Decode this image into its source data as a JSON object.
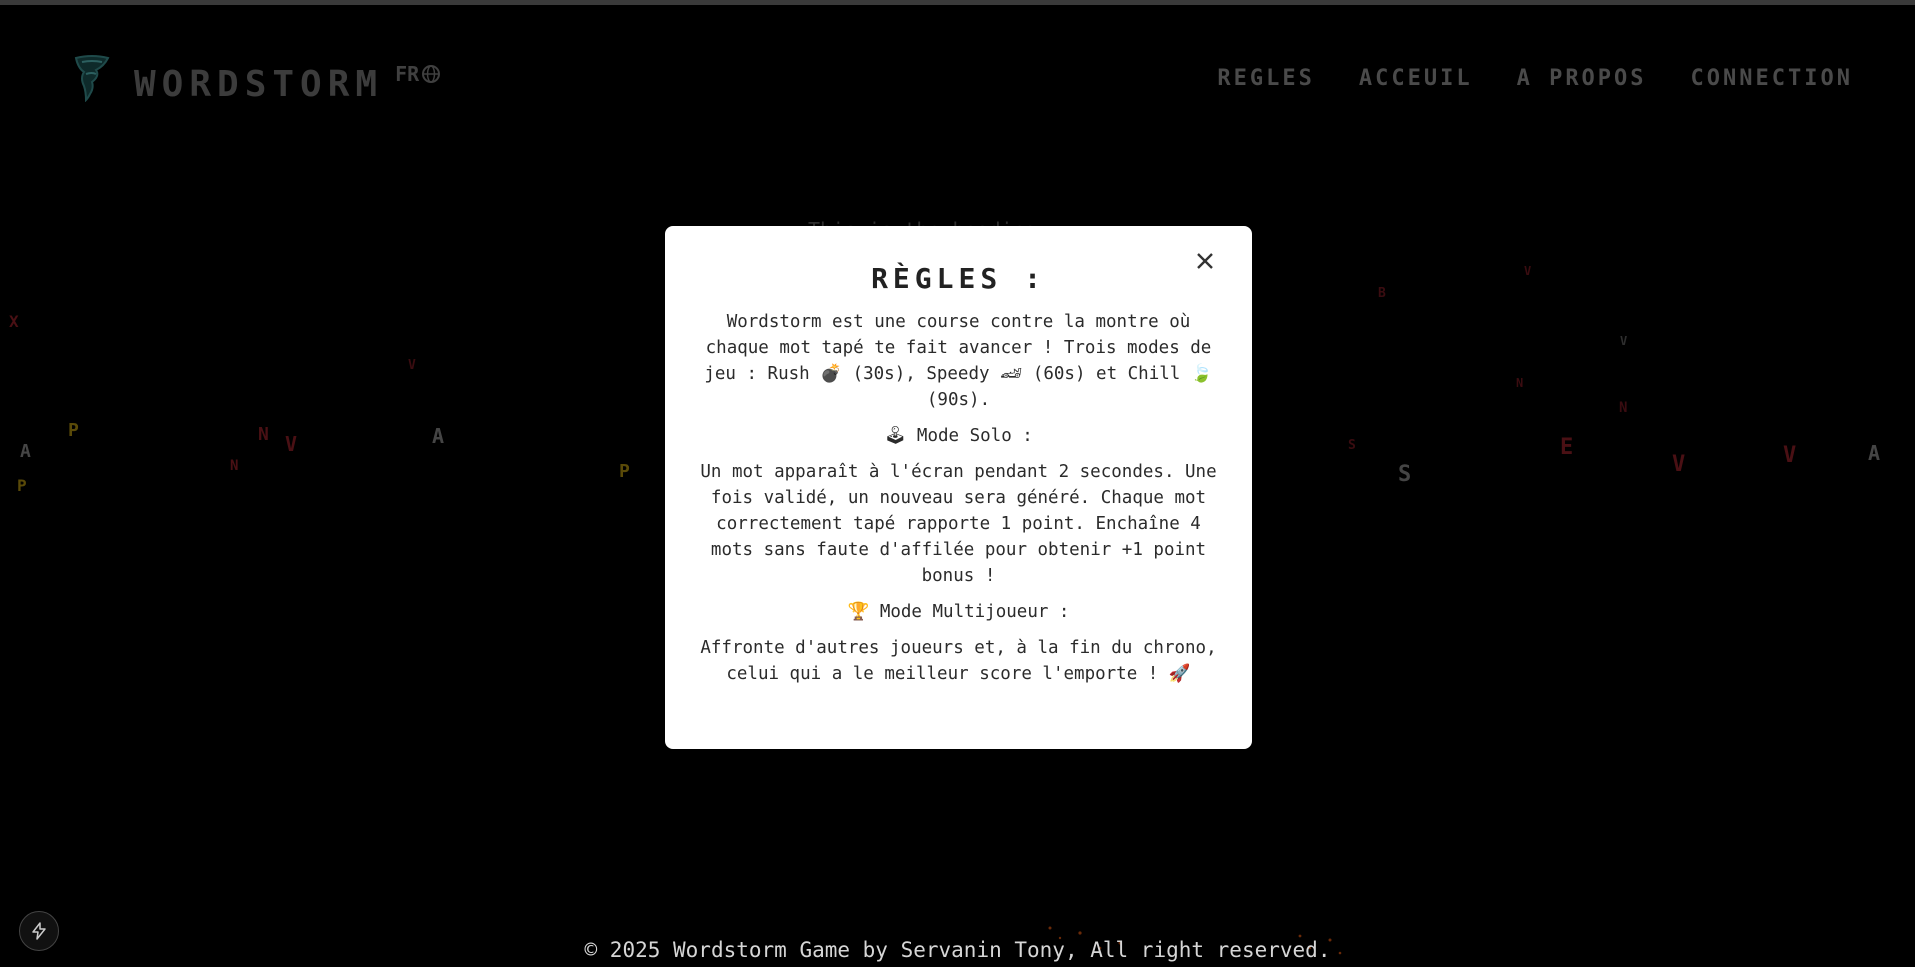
{
  "header": {
    "logo_text": "WORDSTORM",
    "lang": "FR",
    "nav": [
      "REGLES",
      "ACCEUIL",
      "A PROPOS",
      "CONNECTION"
    ]
  },
  "background": {
    "ghost_text": "This is the heading",
    "letters": [
      "X",
      "P",
      "A",
      "P",
      "N",
      "V",
      "N",
      "A",
      "P",
      "V",
      "B",
      "V",
      "N",
      "S",
      "N",
      "V",
      "E",
      "V",
      "S",
      "V",
      "A"
    ]
  },
  "modal": {
    "title": "RÈGLES :",
    "intro": "Wordstorm est une course contre la montre où chaque mot tapé te fait avancer ! Trois modes de jeu : Rush 💣 (30s), Speedy 🏎 (60s) et Chill 🍃 (90s).",
    "solo_title": "🕹 Mode Solo :",
    "solo_text": "Un mot apparaît à l'écran pendant 2 secondes. Une fois validé, un nouveau sera généré. Chaque mot correctement tapé rapporte 1 point. Enchaîne 4 mots sans faute d'affilée pour obtenir +1 point bonus !",
    "multi_title": "🏆 Mode Multijoueur :",
    "multi_text": "Affronte d'autres joueurs et, à la fin du chrono, celui qui a le meilleur score l'emporte ! 🚀"
  },
  "footer": {
    "text": "© 2025 Wordstorm Game by Servanin Tony, All right reserved."
  },
  "colors": {
    "background": "#000000",
    "modal_bg": "#ffffff",
    "letter_red": "#5a1216",
    "letter_yellow": "#5a4a08",
    "letter_grey": "#3c3c3c"
  }
}
